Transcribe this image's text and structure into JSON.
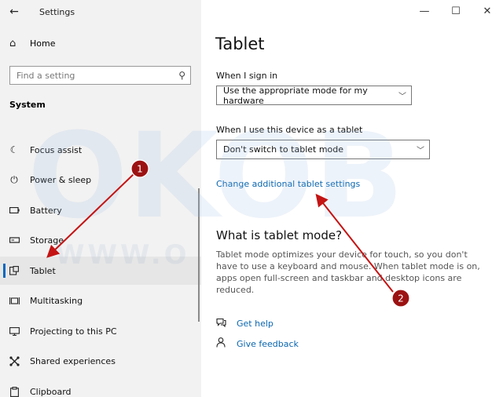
{
  "window": {
    "title": "Settings",
    "controls": {
      "minimize": "—",
      "maximize": "☐",
      "close": "✕"
    }
  },
  "sidebar": {
    "home_label": "Home",
    "search_placeholder": "Find a setting",
    "section_label": "System",
    "items": [
      {
        "label": "Focus assist",
        "icon": "moon-icon"
      },
      {
        "label": "Power & sleep",
        "icon": "power-icon"
      },
      {
        "label": "Battery",
        "icon": "battery-icon"
      },
      {
        "label": "Storage",
        "icon": "storage-icon"
      },
      {
        "label": "Tablet",
        "icon": "tablet-icon",
        "selected": true
      },
      {
        "label": "Multitasking",
        "icon": "multitasking-icon"
      },
      {
        "label": "Projecting to this PC",
        "icon": "projecting-icon"
      },
      {
        "label": "Shared experiences",
        "icon": "shared-experiences-icon"
      },
      {
        "label": "Clipboard",
        "icon": "clipboard-icon"
      }
    ]
  },
  "main": {
    "page_title": "Tablet",
    "sign_in": {
      "label": "When I sign in",
      "value": "Use the appropriate mode for my hardware"
    },
    "as_tablet": {
      "label": "When I use this device as a tablet",
      "value": "Don't switch to tablet mode"
    },
    "change_link": "Change additional tablet settings",
    "what_is_title": "What is tablet mode?",
    "description": "Tablet mode optimizes your device for touch, so you don't have to use a keyboard and mouse. When tablet mode is on, apps open full-screen and taskbar and desktop icons are reduced.",
    "help": {
      "get_help": "Get help",
      "give_feedback": "Give feedback"
    }
  },
  "watermark": {
    "letters": "OKOB",
    "url": "WWW.O"
  },
  "annotations": {
    "badge_1": "1",
    "badge_2": "2",
    "accent": "#b01010"
  },
  "colors": {
    "sidebar_bg": "#f2f2f2",
    "accent": "#0067c0",
    "link": "#0a66b0"
  }
}
